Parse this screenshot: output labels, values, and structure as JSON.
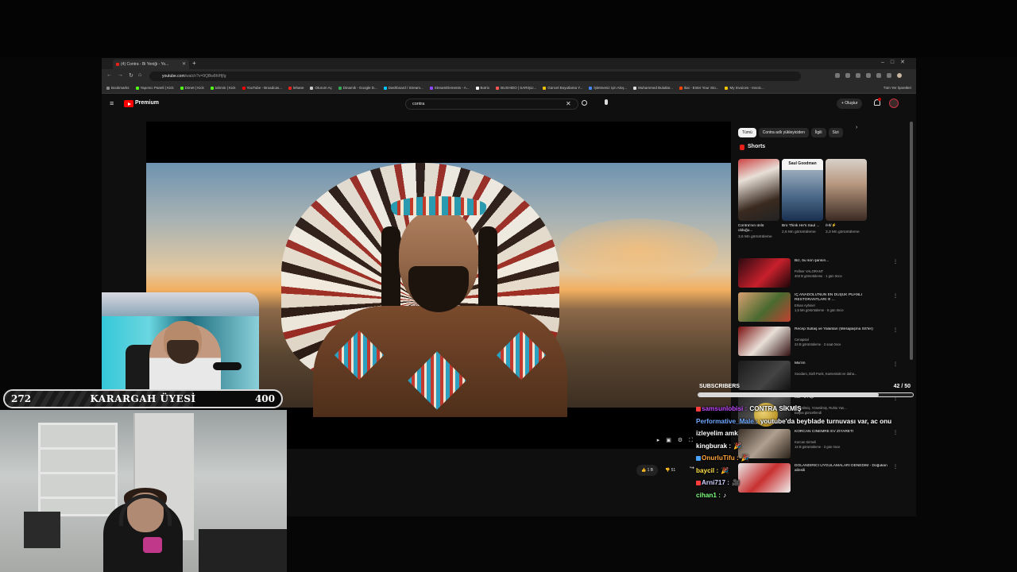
{
  "browser": {
    "tab_title": "(4) Contra - Bi Yeniği - Yo...",
    "url_host": "youtube.com",
    "url_path": "/watch?v=9QBw8hlHjfg",
    "bookmarks": [
      {
        "label": "Bookmarks",
        "color": "#888888"
      },
      {
        "label": "Yapımcı Paneli | Kick",
        "color": "#53fc18"
      },
      {
        "label": "Dönet | Kick",
        "color": "#53fc18"
      },
      {
        "label": "tahmin | Kick",
        "color": "#53fc18"
      },
      {
        "label": "YouTube - Broadcas...",
        "color": "#ff0000"
      },
      {
        "label": "lehane",
        "color": "#e62117"
      },
      {
        "label": "Oturum Aç",
        "color": "#cccccc"
      },
      {
        "label": "Dinamik - Google D...",
        "color": "#34a853"
      },
      {
        "label": "Dashboard / Stream...",
        "color": "#00c8ff"
      },
      {
        "label": "StreamElements - A...",
        "color": "#9146ff"
      },
      {
        "label": "Botrix",
        "color": "#ffffff"
      },
      {
        "label": "BUSHIDO | SARIŞLI...",
        "color": "#ff5555"
      },
      {
        "label": "Güncel Boyutlama Y...",
        "color": "#f0c000"
      },
      {
        "label": "İşletmeniz için Akış...",
        "color": "#4285f4"
      },
      {
        "label": "Muhammed Bulutlar...",
        "color": "#dddddd"
      },
      {
        "label": "ikai - Enter Your Sto...",
        "color": "#ff4400"
      },
      {
        "label": "My Invoices - Invoic...",
        "color": "#f5c400"
      }
    ],
    "bookmarks_right": "Tüm Yer İşaretleri"
  },
  "youtube": {
    "brand": "Premium",
    "search_value": "contra",
    "create_label": "+ Oluştur",
    "chips": [
      "Tümü",
      "Contra adlı yükleyiciden",
      "İlgili",
      "Sizi"
    ],
    "shorts_title": "Shorts",
    "shorts": [
      {
        "title": "Contra'nın ünlü olduğu...",
        "views": "3,6 Mn görüntüleme",
        "overlay": ""
      },
      {
        "title": "Bro Think He's Saul ...",
        "views": "2,6 Mn görüntüleme",
        "overlay": "Saul Goodman"
      },
      {
        "title": "/Hİ/⚡",
        "views": "3,3 Mn görüntüleme",
        "overlay": ""
      }
    ],
    "recommendations": [
      {
        "title": "Biz, bu son şansın...",
        "channel": "Fellner VALORANT",
        "meta": "403 B görüntüleme · 1 gün önce"
      },
      {
        "title": "İÇ ANADOLU'NUN EN DÜŞÜK PUANLI RESTORANTLARI !!! ...",
        "channel": "Erkan Ayhinel",
        "meta": "1,5 Mn görüntüleme · 6 gün önce"
      },
      {
        "title": "Recep Sultaş ve Yalanları (Mesajlaşma SS'ler)",
        "channel": "Cenapsal",
        "meta": "24 B görüntüleme · 3 saat önce"
      },
      {
        "title": "Mix'im",
        "channel": "Soodaro, Daft Punk, Kantentakt ve daha...",
        "meta": ""
      },
      {
        "title": "Mix - J Pop",
        "channel": "Yönetilmiş, Yönetilmiş, Ruhlu Yan...",
        "meta": "Başka güncellendi"
      },
      {
        "title": "KORCAN CİNEMRE EV ZİYARETİ",
        "channel": "Korcan Sirmeli",
        "meta": "14 B görüntüleme · 3 gün önce"
      },
      {
        "title": "DOLANDIRICI UYGULAMALARI DENEDİM - Doğukan alinsili",
        "channel": "",
        "meta": ""
      }
    ],
    "likes": "1 B",
    "dislikes": "51"
  },
  "subscriber_bar": {
    "current": "272",
    "label": "KARARGAH ÜYESİ",
    "goal": "400",
    "progress": 0.68
  },
  "chat": {
    "header": "SUBSCRIBERS",
    "count": "42",
    "goal": "/ 50",
    "progress": 0.84,
    "messages": [
      {
        "user": "samsunlobisi",
        "text": "CONTRA SİKMİŞ",
        "user_color": "#c44dff",
        "badge": "#ff3c3c"
      },
      {
        "user": "Performative_Male",
        "text": "youtube'da beyblade turnuvası var, ac onu izleyelim amk",
        "user_color": "#6fa8ff",
        "badge": ""
      },
      {
        "user": "kingburak",
        "text": "🎉",
        "user_color": "#ffffff",
        "badge": ""
      },
      {
        "user": "OnurluTifu",
        "text": "🎉",
        "user_color": "#ffa43b",
        "badge": "#4aa3ff"
      },
      {
        "user": "baycil",
        "text": "🎉",
        "user_color": "#ffe14a",
        "badge": ""
      },
      {
        "user": "Arni717",
        "text": "🎥",
        "user_color": "#d0d0ff",
        "badge": "#ff3c3c"
      },
      {
        "user": "cihan1",
        "text": "♪",
        "user_color": "#7dff7d",
        "badge": ""
      }
    ]
  }
}
